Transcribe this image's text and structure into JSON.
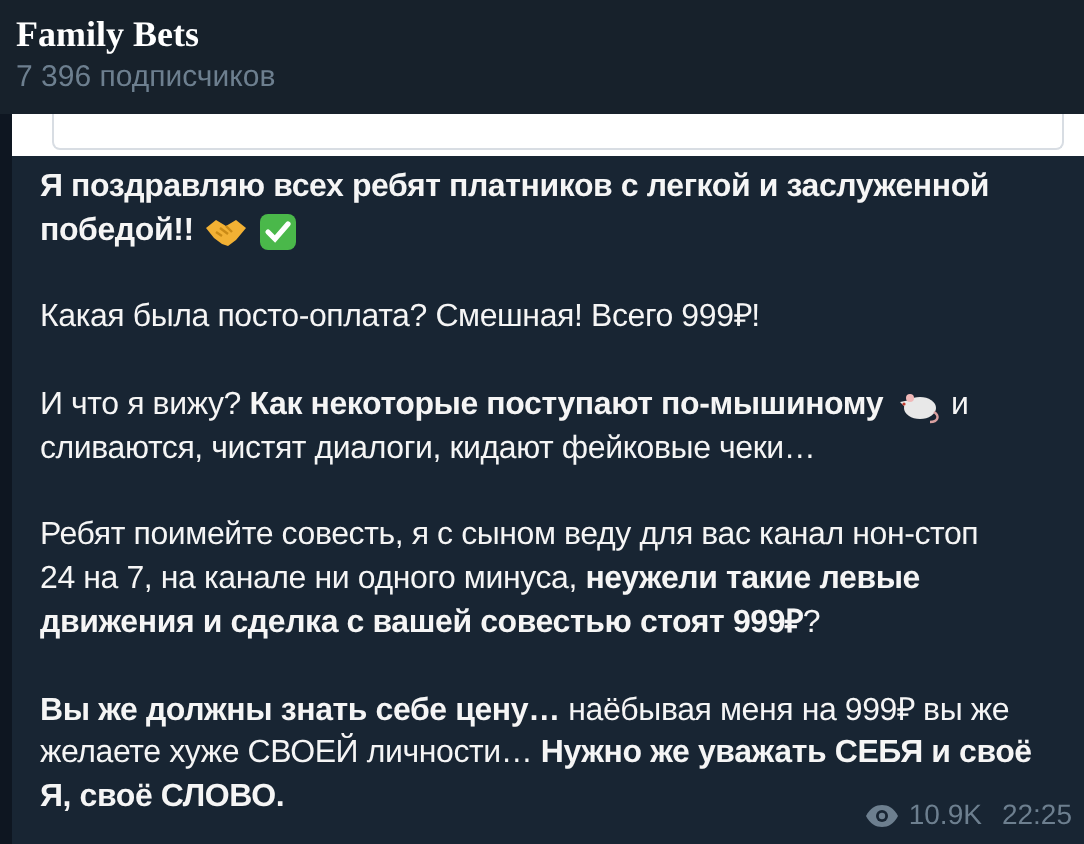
{
  "channel": {
    "title": "Family Bets",
    "subscribers": "7 396 подписчиков"
  },
  "message": {
    "paragraphs": [
      [
        [
          {
            "kind": "text",
            "text": "**Я поздравляю всех ребят платников с легкой и заслуженной**"
          }
        ],
        [
          {
            "kind": "text",
            "text": "**победой!!**"
          },
          {
            "kind": "handshake"
          },
          {
            "kind": "check"
          }
        ]
      ],
      [
        [
          {
            "kind": "text",
            "text": "Какая была посто-оплата? Смешная! Всего 999₽!"
          }
        ]
      ],
      [
        [
          {
            "kind": "text",
            "text": "И что я вижу? **Как некоторые поступают по-мышиному**"
          },
          {
            "kind": "rat"
          },
          {
            "kind": "text",
            "text": "и"
          }
        ],
        [
          {
            "kind": "text",
            "text": "сливаются, чистят диалоги, кидают фейковые чеки…"
          }
        ]
      ],
      [
        [
          {
            "kind": "text",
            "text": "Ребят поимейте совесть, я с сыном веду для вас канал нон-стоп"
          }
        ],
        [
          {
            "kind": "text",
            "text": "24 на 7, на канале ни одного минуса, **неужели такие левые**"
          }
        ],
        [
          {
            "kind": "text",
            "text": "**движения и сделка с вашей совестью стоят 999₽**?"
          }
        ]
      ],
      [
        [
          {
            "kind": "text",
            "text": "**Вы же должны знать себе цену…** наёбывая меня на 999₽ вы же"
          }
        ],
        [
          {
            "kind": "text",
            "text": "желаете хуже СВОЕЙ личности… **Нужно же уважать СЕБЯ и своё**"
          }
        ],
        [
          {
            "kind": "text",
            "text": "**Я, своё СЛОВО.**"
          }
        ]
      ]
    ],
    "views": "10.9K",
    "time": "22:25"
  }
}
